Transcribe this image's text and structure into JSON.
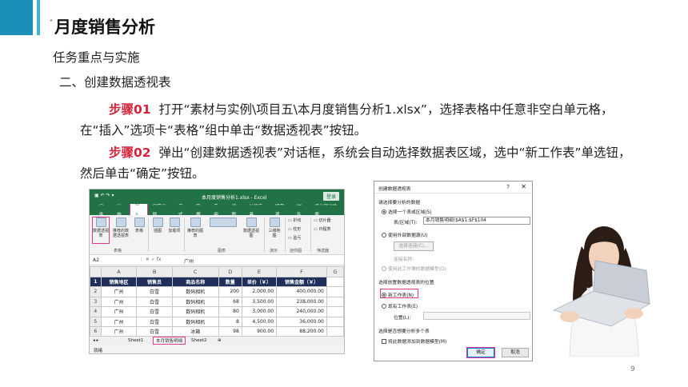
{
  "slide": {
    "title": "月度销售分析",
    "subtitle1": "任务重点与实施",
    "subtitle2": "二、创建数据透视表",
    "steps": [
      {
        "label": "步骤01",
        "text": "打开“素材与实例\\项目五\\本月度销售分析1.xlsx”，选择表格中任意非空白单元格，在“插入”选项卡“表格”组中单击“数据透视表”按钮。"
      },
      {
        "label": "步骤02",
        "text": "弹出“创建数据透视表”对话框，系统会自动选择数据表区域，选中“新工作表”单选钮，然后单击“确定”按钮。"
      }
    ],
    "page_number": "9"
  },
  "excel": {
    "title": "本月度销售分析1.xlsx - Excel",
    "login": "登录",
    "tabs": [
      "文件",
      "开始",
      "插入",
      "页面布局",
      "公式",
      "数据",
      "审阅",
      "视图",
      "开发工具",
      "加载项",
      "团队",
      "操作说明搜索"
    ],
    "active_tab_index": 2,
    "ribbon": {
      "pivot": "数据透视表",
      "recommended_pivot": "推荐的数据透视表",
      "table": "表格",
      "illustrations": "插图",
      "addins": "加载项",
      "recommended_charts": "推荐的图表",
      "pivot_chart": "数据透视图",
      "map3d": "三维地图",
      "sparkline_line": "折线",
      "sparkline_column": "柱形",
      "sparkline_winloss": "盈亏",
      "slicer": "切片器",
      "timeline": "日程表",
      "group_tables": "表格",
      "group_charts": "图表",
      "group_tours": "演示",
      "group_sparklines": "迷你图",
      "group_filters": "筛选器"
    },
    "name_box": "A2",
    "formula_value": "广州",
    "columns": [
      "A",
      "B",
      "C",
      "D",
      "E",
      "F",
      "G"
    ],
    "header_row": [
      "销售地区",
      "销售员",
      "商品名称",
      "数量",
      "单价（￥）",
      "销售金额（￥）"
    ],
    "rows": [
      [
        "广州",
        "白雪",
        "数码相机",
        "200",
        "2,000.00",
        "400,000.00"
      ],
      [
        "广州",
        "白雪",
        "数码相机",
        "68",
        "3,500.00",
        "238,000.00"
      ],
      [
        "广州",
        "白雪",
        "数码相机",
        "80",
        "3,000.00",
        "240,000.00"
      ],
      [
        "广州",
        "白雪",
        "数码相机",
        "8",
        "4,500.00",
        "36,000.00"
      ],
      [
        "广州",
        "白雪",
        "冰箱",
        "98",
        "900.00",
        "88,200.00"
      ]
    ],
    "sheets": [
      "Sheet1",
      "本月销售明细",
      "Sheet2"
    ],
    "status": "就绪"
  },
  "dialog": {
    "title": "创建数据透视表",
    "help": "?",
    "close": "✕",
    "section1": "请选择要分析的数据",
    "opt_select_table": "选择一个表或区域(S)",
    "table_range_label": "表/区域(T):",
    "table_range_value": "本月销售明细!$A$1:$F$104",
    "opt_external": "使用外部数据源(U)",
    "choose_connection": "选择连接(C)...",
    "connection_name": "连接名称:",
    "opt_data_model": "使用此工作簿的数据模型(D)",
    "section2": "选择放置数据透视表的位置",
    "opt_new_sheet": "新工作表(N)",
    "opt_existing_sheet": "现有工作表(E)",
    "location_label": "位置(L):",
    "section3": "选择是否想要分析多个表",
    "add_to_model": "将此数据添加到数据模型(M)",
    "ok": "确定",
    "cancel": "取消"
  }
}
